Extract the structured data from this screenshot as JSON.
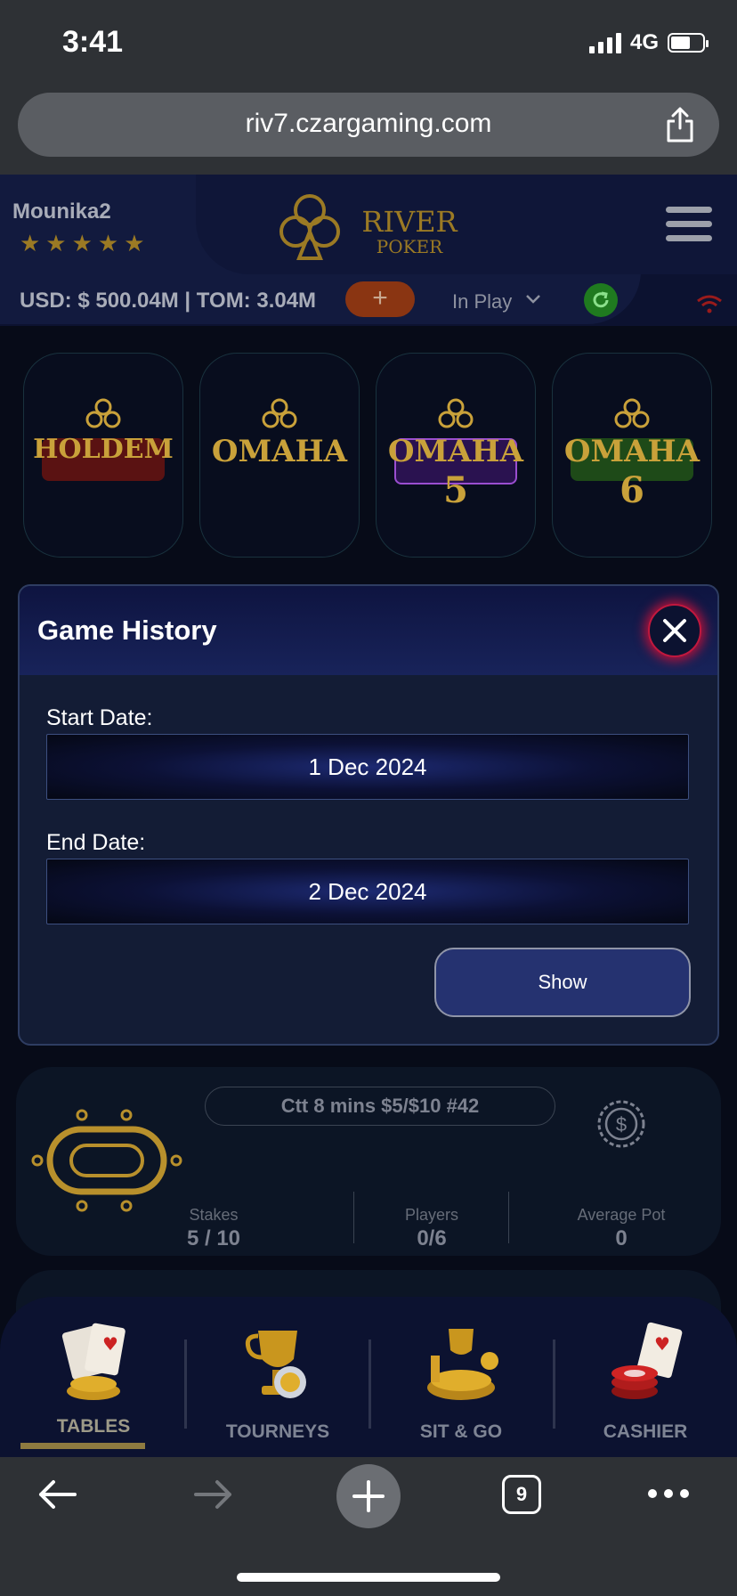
{
  "status_bar": {
    "time": "3:41",
    "network": "4G"
  },
  "browser": {
    "url": "riv7.czargaming.com",
    "open_tabs": "9"
  },
  "header": {
    "username": "Mounika2",
    "rating_stars": 5,
    "stars_text": "★★★★★",
    "balance": "USD: $ 500.04M | TOM: 3.04M",
    "add_label": "+",
    "filter": "In Play",
    "brand": {
      "line1": "RIVER",
      "line2": "POKER"
    }
  },
  "games": [
    {
      "name": "HOLDEM",
      "sub": ""
    },
    {
      "name": "OMAHA",
      "sub": ""
    },
    {
      "name": "OMAHA",
      "sub": "5"
    },
    {
      "name": "OMAHA",
      "sub": "6"
    }
  ],
  "modal": {
    "title": "Game History",
    "start_label": "Start Date:",
    "start_value": "1 Dec 2024",
    "end_label": "End Date:",
    "end_value": "2 Dec 2024",
    "show_label": "Show"
  },
  "table": {
    "name": "Ctt 8 mins $5/$10 #42",
    "stakes_label": "Stakes",
    "stakes_value": "5 / 10",
    "players_label": "Players",
    "players_value": "0/6",
    "avgpot_label": "Average Pot",
    "avgpot_value": "0"
  },
  "nav": [
    {
      "label": "TABLES",
      "active": true
    },
    {
      "label": "TOURNEYS",
      "active": false
    },
    {
      "label": "SIT & GO",
      "active": false
    },
    {
      "label": "CASHIER",
      "active": false
    }
  ],
  "colors": {
    "gold": "#c9a13a",
    "modal_bg": "#131c35",
    "accent_red": "#c0183e",
    "show_button": "#253270"
  }
}
